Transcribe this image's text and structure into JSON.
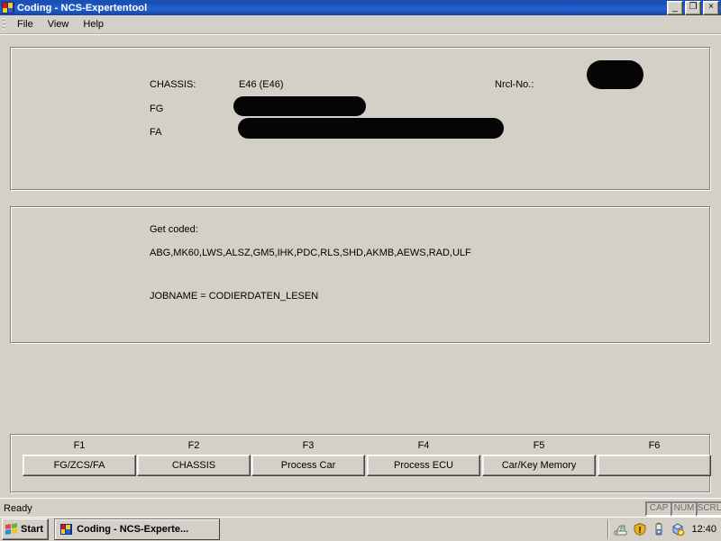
{
  "window": {
    "title": "Coding - NCS-Expertentool",
    "icon": "app-icon",
    "buttons": {
      "minimize": "_",
      "maximize": "❐",
      "close": "×"
    }
  },
  "menubar": {
    "items": [
      {
        "label": "File"
      },
      {
        "label": "View"
      },
      {
        "label": "Help"
      }
    ]
  },
  "vehicle_panel": {
    "chassis_label": "CHASSIS:",
    "chassis_value": "E46 (E46)",
    "fg_label": "FG",
    "fg_value": "",
    "fa_label": "FA",
    "fa_value": "",
    "nrcl_label": "Nrcl-No.:",
    "nrcl_value": "",
    "redaction_note": "redacted"
  },
  "job_panel": {
    "get_coded_label": "Get coded:",
    "ecu_list": "ABG,MK60,LWS,ALSZ,GM5,IHK,PDC,RLS,SHD,AKMB,AEWS,RAD,ULF",
    "jobname": "JOBNAME = CODIERDATEN_LESEN"
  },
  "function_keys": [
    {
      "key": "F1",
      "label": "FG/ZCS/FA"
    },
    {
      "key": "F2",
      "label": "CHASSIS"
    },
    {
      "key": "F3",
      "label": "Process Car"
    },
    {
      "key": "F4",
      "label": "Process ECU"
    },
    {
      "key": "F5",
      "label": "Car/Key Memory"
    },
    {
      "key": "F6",
      "label": ""
    }
  ],
  "statusbar": {
    "message": "Ready",
    "indicators": [
      {
        "label": "CAP"
      },
      {
        "label": "NUM"
      },
      {
        "label": "SCRL"
      }
    ]
  },
  "taskbar": {
    "start_label": "Start",
    "tasks": [
      {
        "label": "Coding - NCS-Experte..."
      }
    ],
    "tray_icons": [
      "network-icon",
      "shield-icon",
      "battery-icon",
      "update-icon"
    ],
    "clock": "12:40"
  },
  "colors": {
    "titlebar": "#1b4fb4",
    "face": "#d4d0c8",
    "redaction": "#050505"
  }
}
